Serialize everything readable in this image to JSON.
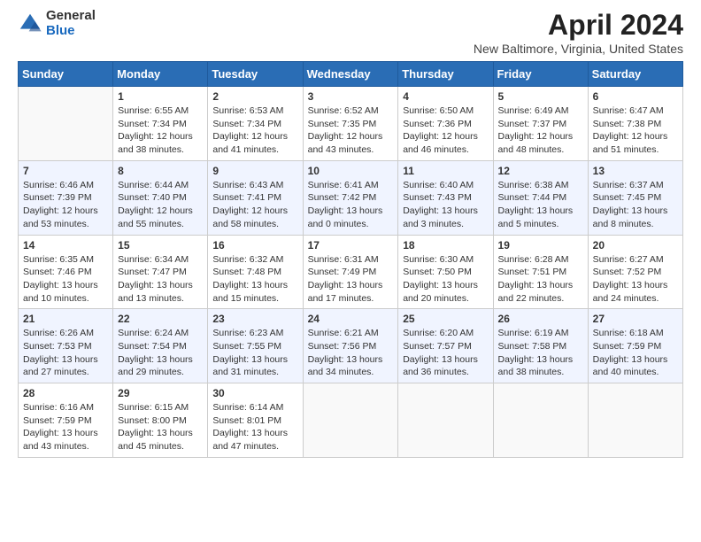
{
  "logo": {
    "general": "General",
    "blue": "Blue"
  },
  "title": "April 2024",
  "location": "New Baltimore, Virginia, United States",
  "days_of_week": [
    "Sunday",
    "Monday",
    "Tuesday",
    "Wednesday",
    "Thursday",
    "Friday",
    "Saturday"
  ],
  "weeks": [
    [
      {
        "day": "",
        "info": ""
      },
      {
        "day": "1",
        "info": "Sunrise: 6:55 AM\nSunset: 7:34 PM\nDaylight: 12 hours\nand 38 minutes."
      },
      {
        "day": "2",
        "info": "Sunrise: 6:53 AM\nSunset: 7:34 PM\nDaylight: 12 hours\nand 41 minutes."
      },
      {
        "day": "3",
        "info": "Sunrise: 6:52 AM\nSunset: 7:35 PM\nDaylight: 12 hours\nand 43 minutes."
      },
      {
        "day": "4",
        "info": "Sunrise: 6:50 AM\nSunset: 7:36 PM\nDaylight: 12 hours\nand 46 minutes."
      },
      {
        "day": "5",
        "info": "Sunrise: 6:49 AM\nSunset: 7:37 PM\nDaylight: 12 hours\nand 48 minutes."
      },
      {
        "day": "6",
        "info": "Sunrise: 6:47 AM\nSunset: 7:38 PM\nDaylight: 12 hours\nand 51 minutes."
      }
    ],
    [
      {
        "day": "7",
        "info": "Sunrise: 6:46 AM\nSunset: 7:39 PM\nDaylight: 12 hours\nand 53 minutes."
      },
      {
        "day": "8",
        "info": "Sunrise: 6:44 AM\nSunset: 7:40 PM\nDaylight: 12 hours\nand 55 minutes."
      },
      {
        "day": "9",
        "info": "Sunrise: 6:43 AM\nSunset: 7:41 PM\nDaylight: 12 hours\nand 58 minutes."
      },
      {
        "day": "10",
        "info": "Sunrise: 6:41 AM\nSunset: 7:42 PM\nDaylight: 13 hours\nand 0 minutes."
      },
      {
        "day": "11",
        "info": "Sunrise: 6:40 AM\nSunset: 7:43 PM\nDaylight: 13 hours\nand 3 minutes."
      },
      {
        "day": "12",
        "info": "Sunrise: 6:38 AM\nSunset: 7:44 PM\nDaylight: 13 hours\nand 5 minutes."
      },
      {
        "day": "13",
        "info": "Sunrise: 6:37 AM\nSunset: 7:45 PM\nDaylight: 13 hours\nand 8 minutes."
      }
    ],
    [
      {
        "day": "14",
        "info": "Sunrise: 6:35 AM\nSunset: 7:46 PM\nDaylight: 13 hours\nand 10 minutes."
      },
      {
        "day": "15",
        "info": "Sunrise: 6:34 AM\nSunset: 7:47 PM\nDaylight: 13 hours\nand 13 minutes."
      },
      {
        "day": "16",
        "info": "Sunrise: 6:32 AM\nSunset: 7:48 PM\nDaylight: 13 hours\nand 15 minutes."
      },
      {
        "day": "17",
        "info": "Sunrise: 6:31 AM\nSunset: 7:49 PM\nDaylight: 13 hours\nand 17 minutes."
      },
      {
        "day": "18",
        "info": "Sunrise: 6:30 AM\nSunset: 7:50 PM\nDaylight: 13 hours\nand 20 minutes."
      },
      {
        "day": "19",
        "info": "Sunrise: 6:28 AM\nSunset: 7:51 PM\nDaylight: 13 hours\nand 22 minutes."
      },
      {
        "day": "20",
        "info": "Sunrise: 6:27 AM\nSunset: 7:52 PM\nDaylight: 13 hours\nand 24 minutes."
      }
    ],
    [
      {
        "day": "21",
        "info": "Sunrise: 6:26 AM\nSunset: 7:53 PM\nDaylight: 13 hours\nand 27 minutes."
      },
      {
        "day": "22",
        "info": "Sunrise: 6:24 AM\nSunset: 7:54 PM\nDaylight: 13 hours\nand 29 minutes."
      },
      {
        "day": "23",
        "info": "Sunrise: 6:23 AM\nSunset: 7:55 PM\nDaylight: 13 hours\nand 31 minutes."
      },
      {
        "day": "24",
        "info": "Sunrise: 6:21 AM\nSunset: 7:56 PM\nDaylight: 13 hours\nand 34 minutes."
      },
      {
        "day": "25",
        "info": "Sunrise: 6:20 AM\nSunset: 7:57 PM\nDaylight: 13 hours\nand 36 minutes."
      },
      {
        "day": "26",
        "info": "Sunrise: 6:19 AM\nSunset: 7:58 PM\nDaylight: 13 hours\nand 38 minutes."
      },
      {
        "day": "27",
        "info": "Sunrise: 6:18 AM\nSunset: 7:59 PM\nDaylight: 13 hours\nand 40 minutes."
      }
    ],
    [
      {
        "day": "28",
        "info": "Sunrise: 6:16 AM\nSunset: 7:59 PM\nDaylight: 13 hours\nand 43 minutes."
      },
      {
        "day": "29",
        "info": "Sunrise: 6:15 AM\nSunset: 8:00 PM\nDaylight: 13 hours\nand 45 minutes."
      },
      {
        "day": "30",
        "info": "Sunrise: 6:14 AM\nSunset: 8:01 PM\nDaylight: 13 hours\nand 47 minutes."
      },
      {
        "day": "",
        "info": ""
      },
      {
        "day": "",
        "info": ""
      },
      {
        "day": "",
        "info": ""
      },
      {
        "day": "",
        "info": ""
      }
    ]
  ]
}
